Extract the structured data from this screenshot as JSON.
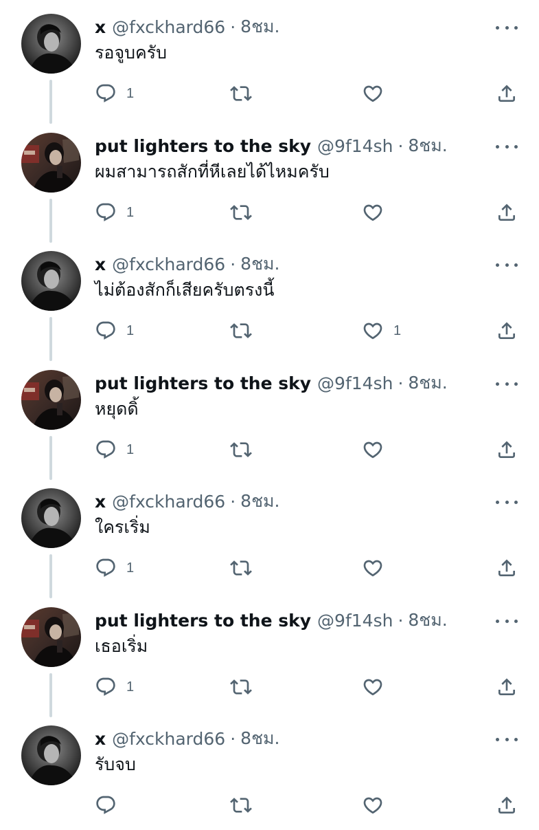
{
  "tweets": [
    {
      "account": "x",
      "name": "x",
      "handle": "@fxckhard66",
      "separator": "·",
      "time": "8ชม.",
      "text": "รอจูบครับ",
      "reply_count": "1",
      "retweet_count": "",
      "like_count": "",
      "thread_line": true
    },
    {
      "account": "put",
      "name": "put lighters to the sky",
      "handle": "@9f14sh",
      "separator": "·",
      "time": "8ชม.",
      "text": "ผมสามารถสักที่หีเลยได้ไหมครับ",
      "reply_count": "1",
      "retweet_count": "",
      "like_count": "",
      "thread_line": true
    },
    {
      "account": "x",
      "name": "x",
      "handle": "@fxckhard66",
      "separator": "·",
      "time": "8ชม.",
      "text": "ไม่ต้องสักก็เสียครับตรงนี้",
      "reply_count": "1",
      "retweet_count": "",
      "like_count": "1",
      "thread_line": true
    },
    {
      "account": "put",
      "name": "put lighters to the sky",
      "handle": "@9f14sh",
      "separator": "·",
      "time": "8ชม.",
      "text": "หยุดดิ้",
      "reply_count": "1",
      "retweet_count": "",
      "like_count": "",
      "thread_line": true
    },
    {
      "account": "x",
      "name": "x",
      "handle": "@fxckhard66",
      "separator": "·",
      "time": "8ชม.",
      "text": "ใครเริ่ม",
      "reply_count": "1",
      "retweet_count": "",
      "like_count": "",
      "thread_line": true
    },
    {
      "account": "put",
      "name": "put lighters to the sky",
      "handle": "@9f14sh",
      "separator": "·",
      "time": "8ชม.",
      "text": "เธอเริ่ม",
      "reply_count": "1",
      "retweet_count": "",
      "like_count": "",
      "thread_line": true
    },
    {
      "account": "x",
      "name": "x",
      "handle": "@fxckhard66",
      "separator": "·",
      "time": "8ชม.",
      "text": "รับจบ",
      "reply_count": "",
      "retweet_count": "",
      "like_count": "",
      "thread_line": false
    }
  ],
  "icons": {
    "reply": "reply-icon",
    "retweet": "retweet-icon",
    "like": "like-icon",
    "share": "share-icon",
    "more": "more-icon"
  },
  "colors": {
    "text": "#0f1419",
    "secondary": "#536471",
    "thread_line": "#cfd9de"
  }
}
